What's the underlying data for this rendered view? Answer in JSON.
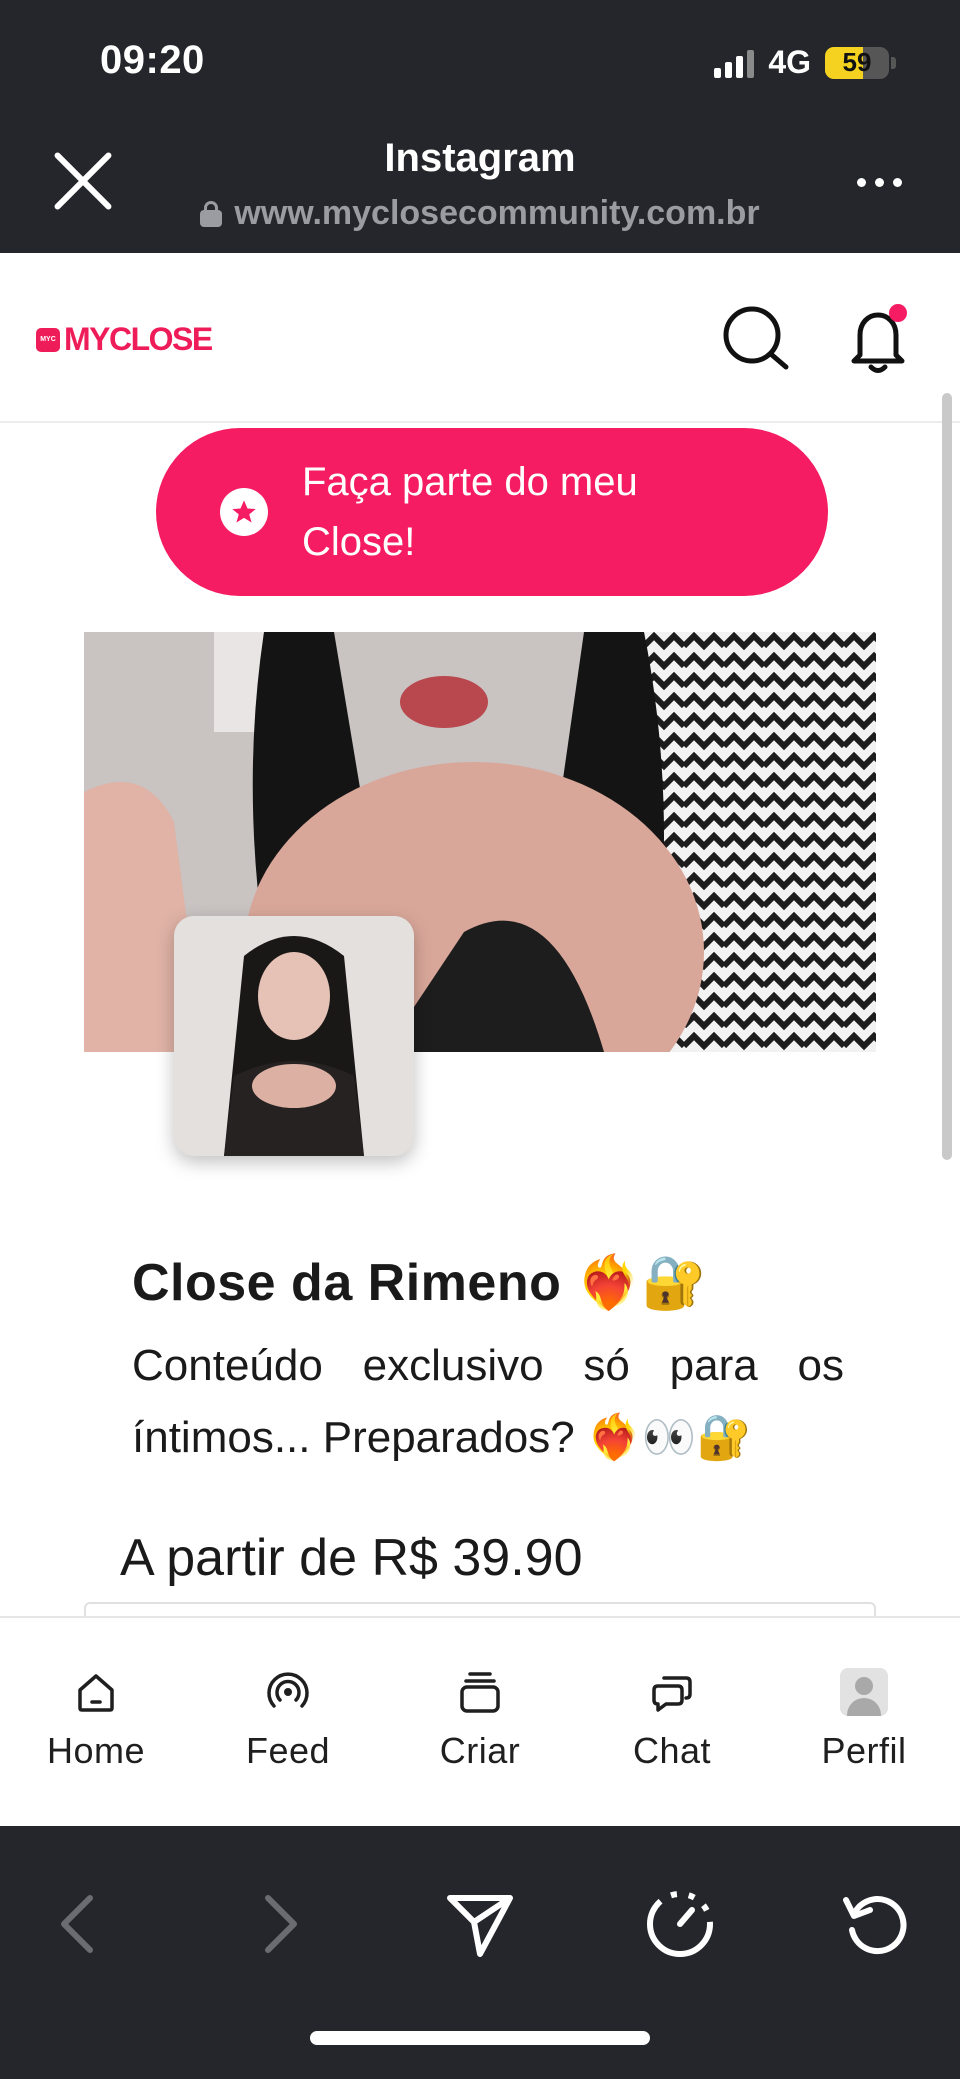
{
  "status_bar": {
    "time": "09:20",
    "network": "4G",
    "battery": "59",
    "battery_level": 0.59
  },
  "browser": {
    "close_icon": "close-icon",
    "title": "Instagram",
    "url": "www.myclosecommunity.com.br",
    "more_icon": "more-dots-icon"
  },
  "site": {
    "logo_mark": "MYC",
    "logo_text": "MYCLOSE",
    "accent": "#f51c63",
    "search_icon": "search-icon",
    "bell_icon": "bell-icon",
    "has_notification": true
  },
  "cta": {
    "icon": "star-icon",
    "label": "Faça parte do meu Close!"
  },
  "profile": {
    "name": "Close da Rimeno ❤️‍🔥🔐",
    "bio": "Conteúdo exclusivo só para os íntimos... Preparados? ❤️‍🔥👀🔐",
    "price": "A partir de R$ 39.90"
  },
  "bottom_nav": {
    "items": [
      {
        "label": "Home",
        "icon": "home-icon"
      },
      {
        "label": "Feed",
        "icon": "broadcast-icon"
      },
      {
        "label": "Criar",
        "icon": "stack-icon"
      },
      {
        "label": "Chat",
        "icon": "chat-icon"
      },
      {
        "label": "Perfil",
        "icon": "avatar-icon"
      }
    ]
  },
  "browser_toolbar": {
    "icons": [
      "back-icon",
      "forward-icon",
      "share-icon",
      "speed-icon",
      "reload-icon"
    ]
  }
}
